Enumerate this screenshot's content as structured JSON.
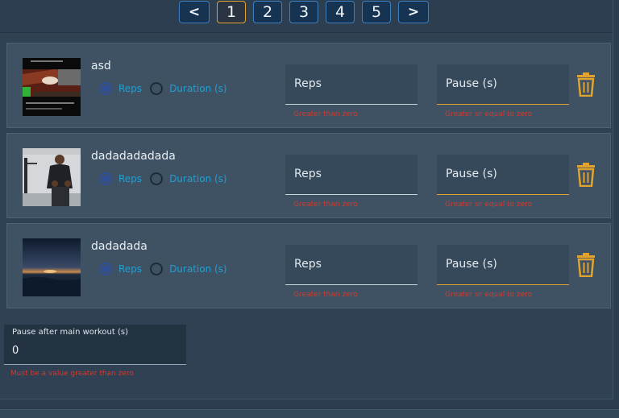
{
  "pagination": {
    "prev": "<",
    "next": ">",
    "pages": [
      "1",
      "2",
      "3",
      "4",
      "5"
    ],
    "active_page": "1"
  },
  "exercises": [
    {
      "name": "asd",
      "mode_options": [
        "Reps",
        "Duration (s)"
      ],
      "selected_mode": "Reps",
      "reps_placeholder": "Reps",
      "reps_error": "Greater than zero",
      "pause_placeholder": "Pause (s)",
      "pause_error": "Greater or equal to zero"
    },
    {
      "name": "dadadadadada",
      "mode_options": [
        "Reps",
        "Duration (s)"
      ],
      "selected_mode": "Reps",
      "reps_placeholder": "Reps",
      "reps_error": "Greater than zero",
      "pause_placeholder": "Pause (s)",
      "pause_error": "Greater or equal to zero"
    },
    {
      "name": "dadadada",
      "mode_options": [
        "Reps",
        "Duration (s)"
      ],
      "selected_mode": "Reps",
      "reps_placeholder": "Reps",
      "reps_error": "Greater than zero",
      "pause_placeholder": "Pause (s)",
      "pause_error": "Greater or equal to zero"
    }
  ],
  "final_pause": {
    "label": "Pause after main workout (s)",
    "value": "0",
    "error": "Must be a value greater than zero"
  },
  "colors": {
    "accent": "#e3a32a",
    "link_blue": "#1e9fd6",
    "error_red": "#d33a2e",
    "page_button": "#163452"
  },
  "icons": {
    "delete": "trash-icon"
  }
}
